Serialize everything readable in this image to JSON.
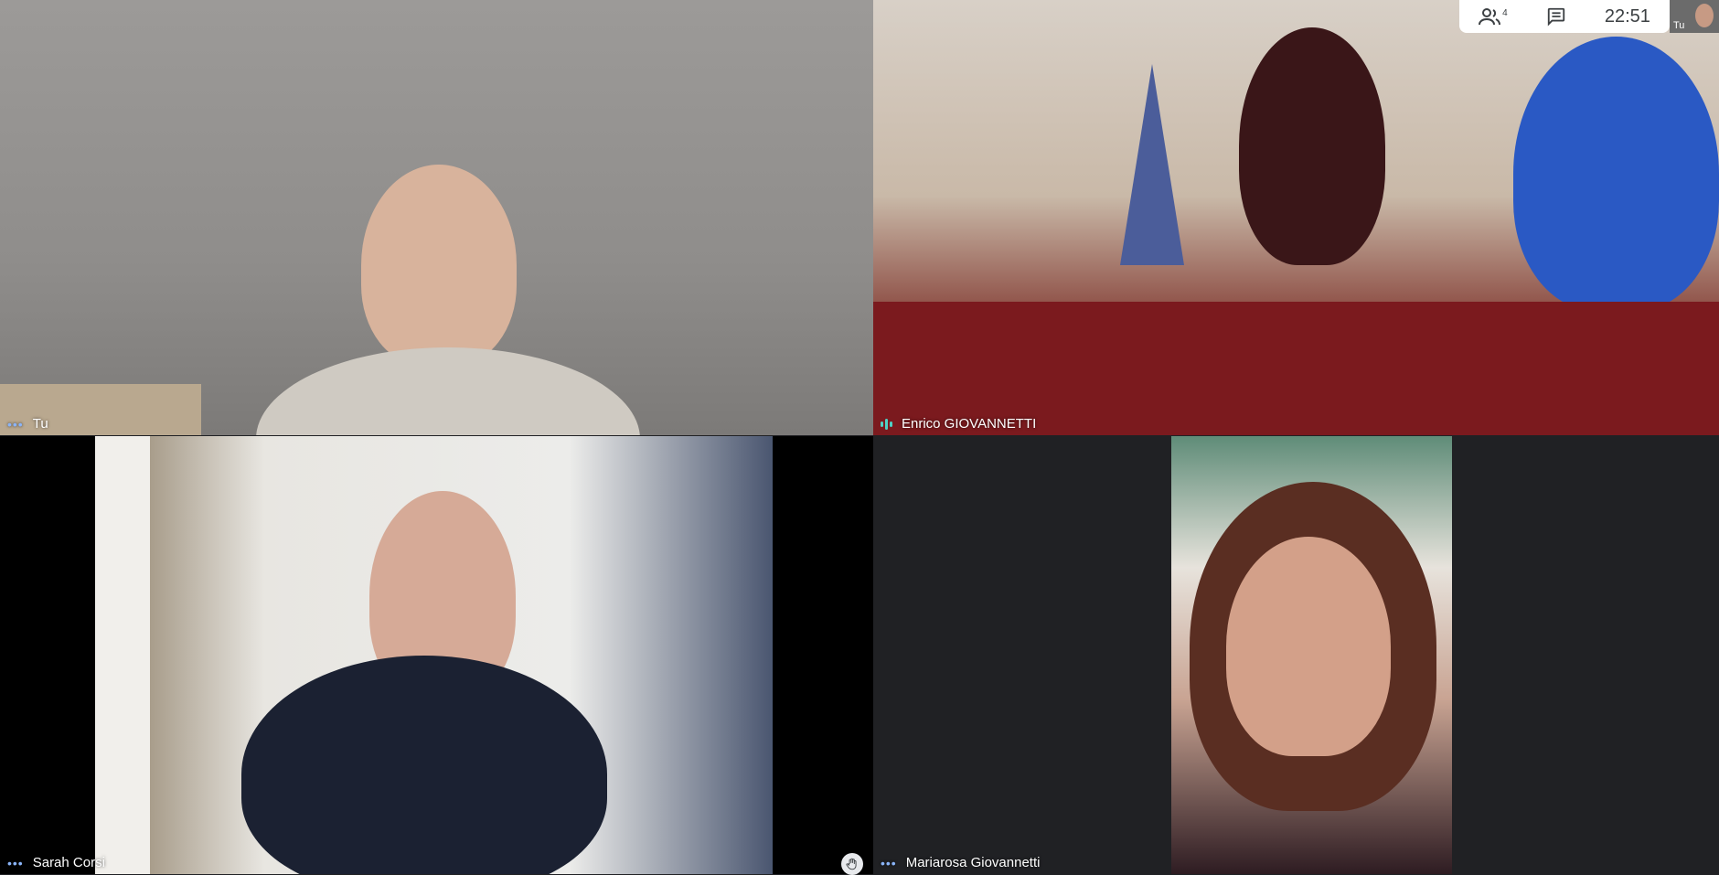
{
  "top_bar": {
    "participants_count": "4",
    "time": "22:51",
    "self_label": "Tu"
  },
  "tiles": [
    {
      "name": "Tu",
      "indicator": "dots"
    },
    {
      "name": "Enrico GIOVANNETTI",
      "indicator": "speaking"
    },
    {
      "name": "Sarah Corsi",
      "indicator": "dots"
    },
    {
      "name": "Mariarosa Giovannetti",
      "indicator": "dots"
    }
  ],
  "icons": {
    "participants": "people-icon",
    "chat": "chat-icon",
    "raise_hand": "hand-icon",
    "more": "more-dots-icon",
    "speaking": "audio-level-icon"
  }
}
